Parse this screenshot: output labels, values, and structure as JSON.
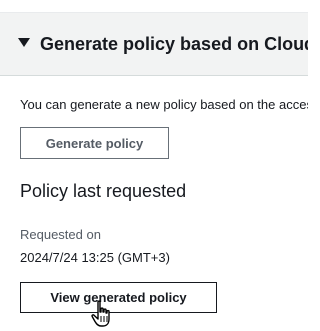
{
  "section": {
    "title": "Generate policy based on CloudTrail events",
    "description": "You can generate a new policy based on the access activity for this role, then customize, create, and attach it to this role."
  },
  "buttons": {
    "generate_label": "Generate policy",
    "view_label": "View generated policy"
  },
  "last_request": {
    "heading": "Policy last requested",
    "requested_on_label": "Requested on",
    "requested_on_value": "2024/7/24 13:25 (GMT+3)"
  },
  "icons": {
    "section_toggle": "caret-down-icon",
    "pointer": "hand-pointer-cursor-icon"
  },
  "colors": {
    "header_bg": "#f2f3f3",
    "text": "#16191f",
    "secondary_text": "#545b64",
    "button_border": "#687078"
  }
}
